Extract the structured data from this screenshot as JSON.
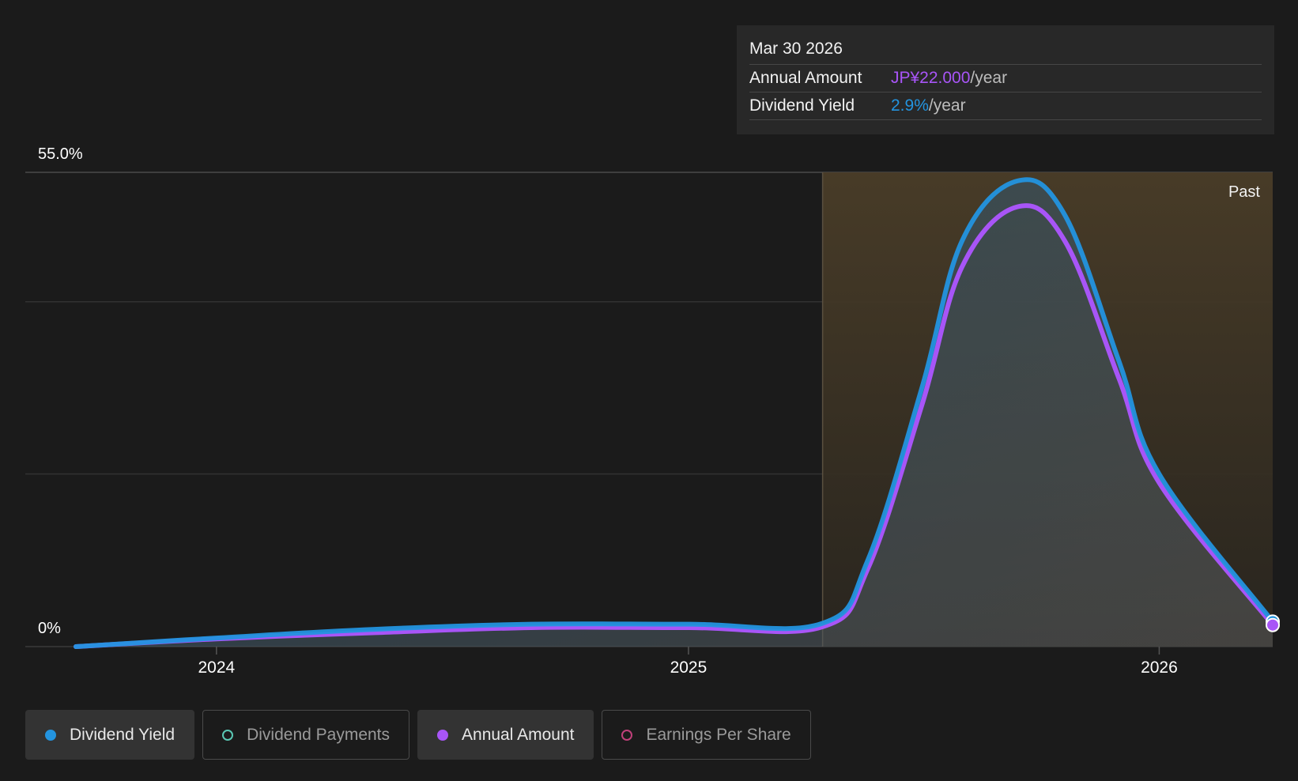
{
  "colors": {
    "background": "#1b1b1b",
    "dividend_yield": "#2394df",
    "dividend_payments": "#5ac8b4",
    "annual_amount": "#a855f7",
    "earnings_per_share": "#c0407a",
    "past_region": "#3e3526",
    "grid": "#3a3a3a"
  },
  "tooltip": {
    "date": "Mar 30 2026",
    "rows": [
      {
        "label": "Annual Amount",
        "value": "JP¥22.000",
        "suffix": "/year",
        "color": "#a855f7"
      },
      {
        "label": "Dividend Yield",
        "value": "2.9%",
        "suffix": "/year",
        "color": "#2394df"
      }
    ]
  },
  "legend": [
    {
      "label": "Dividend Yield",
      "color": "#2394df",
      "active": true,
      "icon": "filled-dot-icon"
    },
    {
      "label": "Dividend Payments",
      "color": "#5ac8b4",
      "active": false,
      "icon": "hollow-dot-icon"
    },
    {
      "label": "Annual Amount",
      "color": "#a855f7",
      "active": true,
      "icon": "filled-dot-icon"
    },
    {
      "label": "Earnings Per Share",
      "color": "#c0407a",
      "active": false,
      "icon": "hollow-dot-icon"
    }
  ],
  "chart_data": {
    "type": "area",
    "y_top_label": "55.0%",
    "y_bottom_label": "0%",
    "ylim": [
      0,
      55
    ],
    "xlim": [
      "2023-09-14",
      "2026-03-30"
    ],
    "x_ticks": [
      {
        "date": "2024-01-01",
        "label": "2024"
      },
      {
        "date": "2025-01-01",
        "label": "2025"
      },
      {
        "date": "2026-01-01",
        "label": "2026"
      }
    ],
    "past_region": {
      "start": "2025-04-15",
      "end": "2026-03-30",
      "label": "Past"
    },
    "grid": true,
    "series": [
      {
        "name": "Dividend Yield",
        "color": "#2394df",
        "points": [
          [
            "2023-09-14",
            0.0
          ],
          [
            "2024-01-01",
            1.0
          ],
          [
            "2024-05-01",
            2.0
          ],
          [
            "2024-09-01",
            2.6
          ],
          [
            "2025-01-01",
            2.6
          ],
          [
            "2025-04-15",
            2.7
          ],
          [
            "2025-05-20",
            10.0
          ],
          [
            "2025-07-01",
            30.0
          ],
          [
            "2025-08-01",
            47.0
          ],
          [
            "2025-09-13",
            54.0
          ],
          [
            "2025-10-20",
            50.0
          ],
          [
            "2025-12-01",
            33.0
          ],
          [
            "2026-01-01",
            20.0
          ],
          [
            "2026-03-30",
            2.9
          ]
        ]
      },
      {
        "name": "Annual Amount",
        "color": "#a855f7",
        "points": [
          [
            "2023-09-14",
            0.0
          ],
          [
            "2024-01-01",
            0.9
          ],
          [
            "2024-05-01",
            1.6
          ],
          [
            "2024-09-01",
            2.2
          ],
          [
            "2025-01-01",
            2.2
          ],
          [
            "2025-04-15",
            2.3
          ],
          [
            "2025-05-20",
            9.0
          ],
          [
            "2025-07-01",
            28.0
          ],
          [
            "2025-08-01",
            44.0
          ],
          [
            "2025-09-13",
            51.0
          ],
          [
            "2025-10-20",
            47.0
          ],
          [
            "2025-12-01",
            31.0
          ],
          [
            "2026-01-01",
            19.0
          ],
          [
            "2026-03-30",
            2.5
          ]
        ]
      }
    ]
  }
}
